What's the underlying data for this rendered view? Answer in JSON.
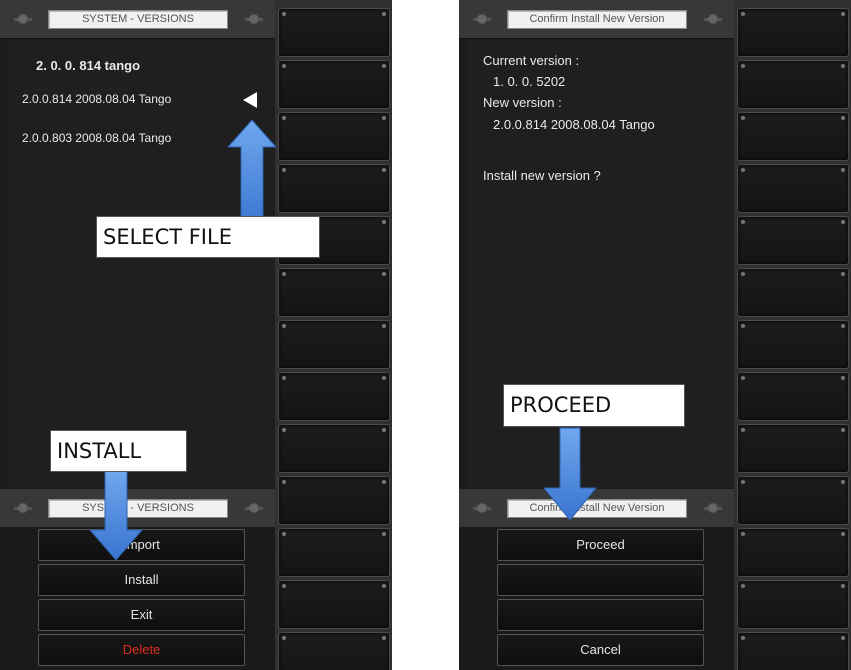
{
  "left": {
    "title": "SYSTEM - VERSIONS",
    "current_header": "2. 0. 0. 814 tango",
    "versions": [
      {
        "label": "2.0.0.814 2008.08.04 Tango",
        "selected": true
      },
      {
        "label": "2.0.0.803 2008.08.04 Tango",
        "selected": false
      }
    ],
    "bottom_title": "SYSTEM - VERSIONS",
    "menu": [
      {
        "label": "Import",
        "color": "#e5e5e5"
      },
      {
        "label": "Install",
        "color": "#e5e5e5"
      },
      {
        "label": "Exit",
        "color": "#e5e5e5"
      },
      {
        "label": "Delete",
        "color": "#e0301e"
      }
    ],
    "annotation_select": "SELECT FILE",
    "annotation_install": "INSTALL"
  },
  "right": {
    "title": "Confirm Install New Version",
    "current_label": "Current version :",
    "current_value": "1. 0. 0. 5202",
    "new_label": "New version :",
    "new_value": "2.0.0.814 2008.08.04 Tango",
    "question": "Install new version ?",
    "bottom_title": "Confirm Install New Version",
    "menu": [
      {
        "label": "Proceed"
      },
      {
        "label": ""
      },
      {
        "label": ""
      },
      {
        "label": "Cancel"
      }
    ],
    "annotation_proceed": "PROCEED"
  },
  "colors": {
    "arrow_blue": "#4a8ae0",
    "panel_dark": "#1b1b1b",
    "delete_red": "#e0301e"
  }
}
